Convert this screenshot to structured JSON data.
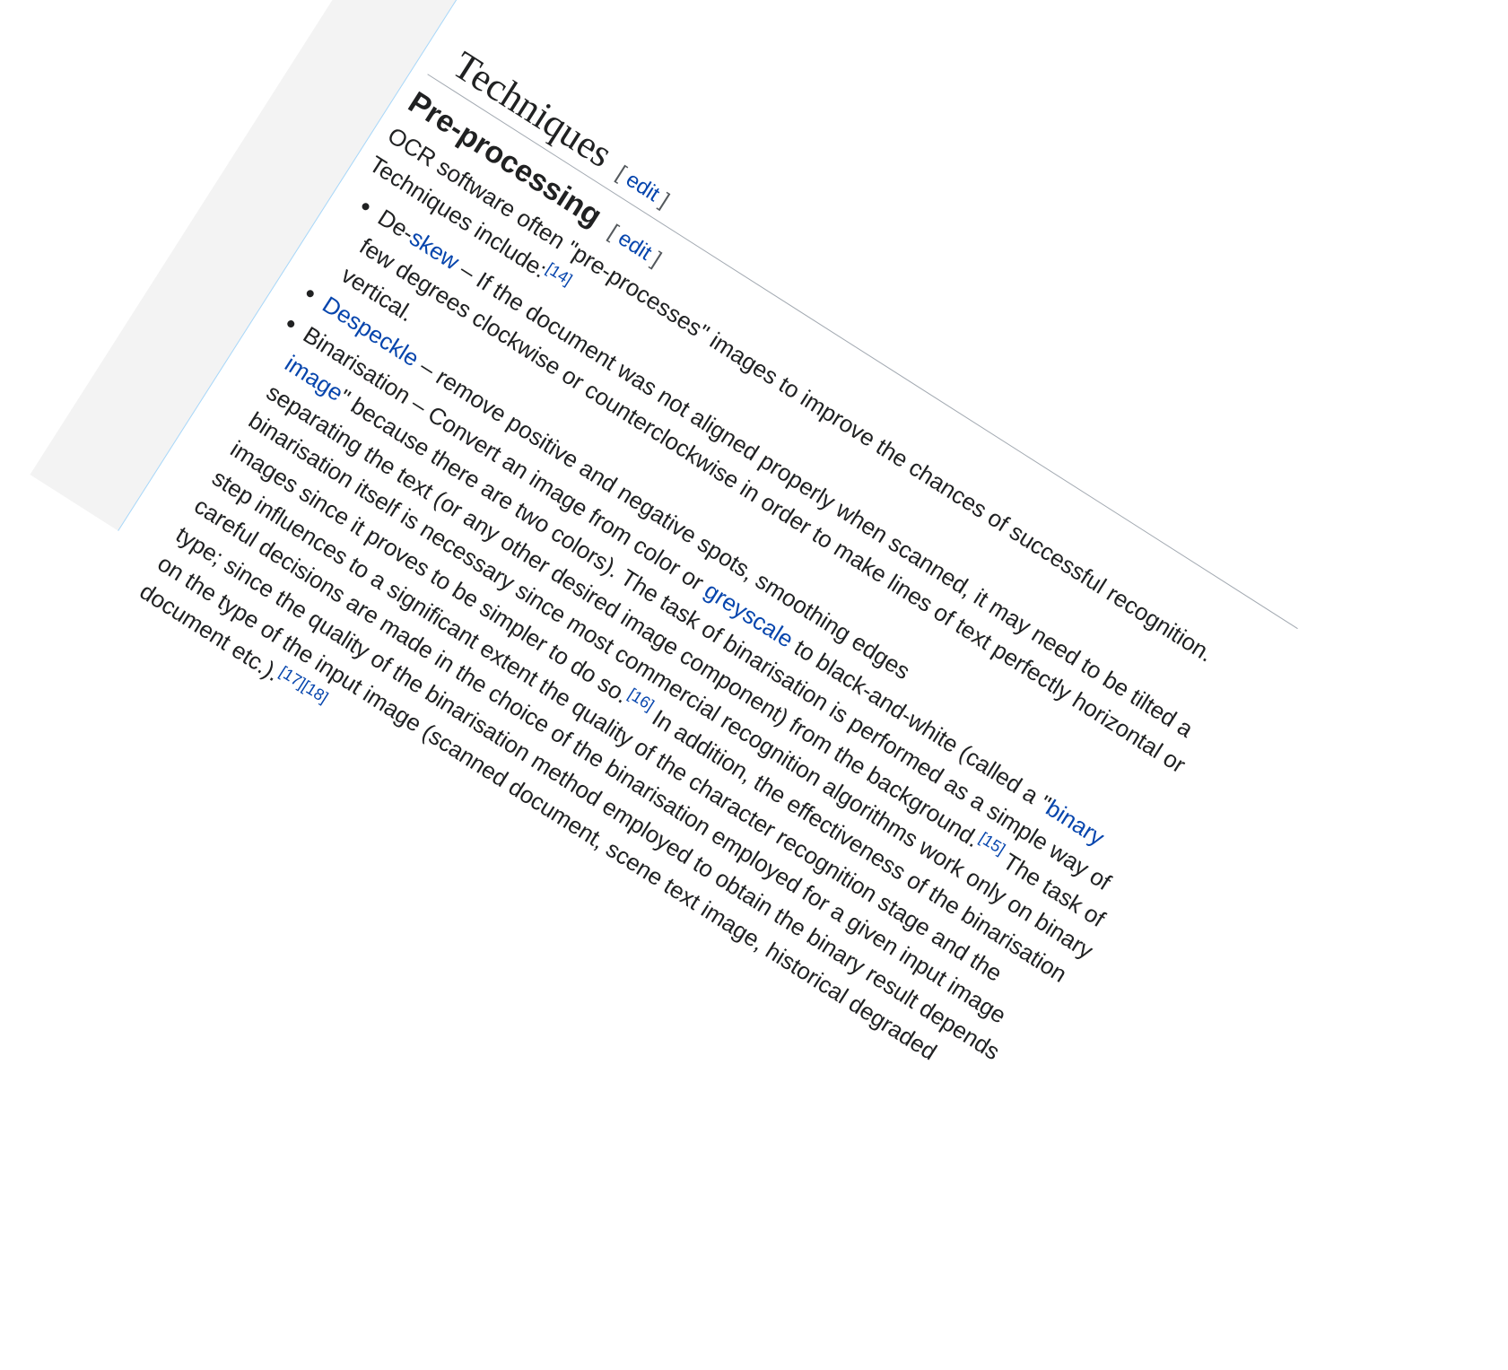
{
  "section": {
    "title": "Techniques",
    "edit_open": "[",
    "edit_label": "edit",
    "edit_close": "]"
  },
  "subsection": {
    "title": "Pre-processing",
    "edit_open": "[",
    "edit_label": "edit",
    "edit_close": "]"
  },
  "intro": {
    "text": "OCR software often \"pre-processes\" images to improve the chances of successful recognition. Techniques include:",
    "ref": "[14]"
  },
  "items": [
    {
      "prefix": "De-",
      "link": "skew",
      "text": " – If the document was not aligned properly when scanned, it may need to be tilted a few degrees clockwise or counterclockwise in order to make lines of text perfectly horizontal or vertical."
    },
    {
      "link": "Despeckle",
      "text": " – remove positive and negative spots, smoothing edges"
    },
    {
      "text_a": "Binarisation – Convert an image from color or ",
      "link_a": "greyscale",
      "text_b": " to black-and-white (called a \"",
      "link_b": "binary image",
      "text_c": "\" because there are two colors).  The task of binarisation is performed as a simple way of separating the text (or any other desired image component) from the background.",
      "ref_a": "[15]",
      "text_d": " The task of binarisation itself is necessary since most commercial recognition algorithms work only on binary images since it proves to be simpler to do so.",
      "ref_b": "[16]",
      "text_e": " In addition, the effectiveness of the binarisation step influences to a significant extent the quality of the character recognition stage and the careful decisions are made in the choice of the binarisation employed for a given input image type; since the quality of the binarisation method employed to obtain the binary result depends on the type of the input image (scanned document, scene text image, historical degraded document etc.).",
      "ref_c": "[17]",
      "ref_d": "[18]"
    }
  ],
  "colors": {
    "link": "#0645ad",
    "text": "#202122",
    "rule": "#a2a9b1",
    "strip_bg": "#f3f3f3",
    "strip_border": "#a7d7f9"
  }
}
